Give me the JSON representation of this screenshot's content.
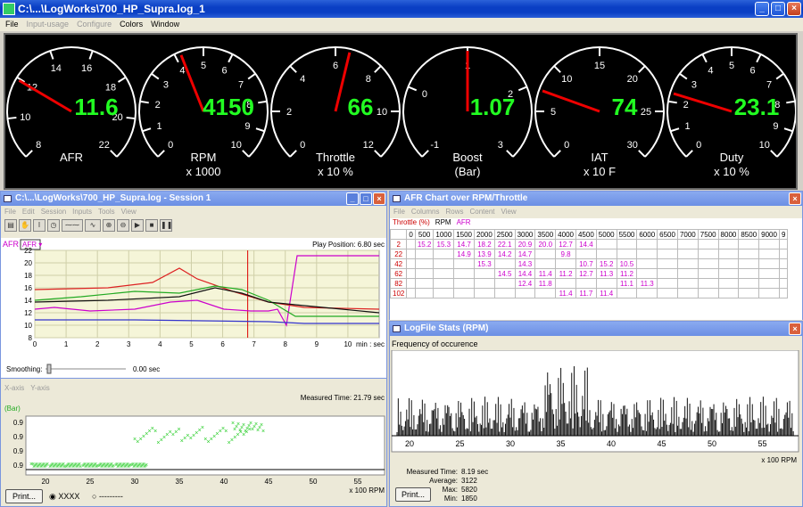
{
  "app": {
    "title": "C:\\...\\LogWorks\\700_HP_Supra.log_1"
  },
  "menu": {
    "items": [
      "File",
      "Input-usage",
      "Configure",
      "Colors",
      "Window"
    ],
    "disabled": [
      false,
      true,
      true,
      false,
      false
    ]
  },
  "gauges": [
    {
      "label": "AFR",
      "sub": "",
      "value": "11.6",
      "ticks": [
        "8",
        "10",
        "12",
        "14",
        "16",
        "18",
        "20",
        "22"
      ],
      "needle": 0.28
    },
    {
      "label": "RPM",
      "sub": "x 1000",
      "value": "4150",
      "ticks": [
        "0",
        "1",
        "2",
        "3",
        "4",
        "5",
        "6",
        "7",
        "8",
        "9",
        "10"
      ],
      "needle": 0.42
    },
    {
      "label": "Throttle",
      "sub": "x 10 %",
      "value": "66",
      "ticks": [
        "0",
        "2",
        "4",
        "6",
        "8",
        "10",
        "12"
      ],
      "needle": 0.55
    },
    {
      "label": "Boost",
      "sub": "(Bar)",
      "value": "1.07",
      "ticks": [
        "-1",
        "0",
        "1",
        "2",
        "3"
      ],
      "needle": 0.5
    },
    {
      "label": "IAT",
      "sub": "x 10 F",
      "value": "74",
      "ticks": [
        "0",
        "5",
        "10",
        "15",
        "20",
        "25",
        "30"
      ],
      "needle": 0.24
    },
    {
      "label": "Duty",
      "sub": "x 10 %",
      "value": "23.1",
      "ticks": [
        "0",
        "1",
        "2",
        "3",
        "4",
        "5",
        "6",
        "7",
        "8",
        "9",
        "10"
      ],
      "needle": 0.23
    }
  ],
  "session": {
    "title": "C:\\...\\LogWorks\\700_HP_Supra.log - Session 1",
    "menu": [
      "File",
      "Edit",
      "Session",
      "Inputs",
      "Tools",
      "View"
    ],
    "channel_label": "AFR",
    "channel_select": "AFR",
    "play_position": "Play Position: 6.80 sec",
    "yticks": [
      "8",
      "10",
      "12",
      "14",
      "16",
      "18",
      "20",
      "22"
    ],
    "xticks": [
      "0",
      "1",
      "2",
      "3",
      "4",
      "5",
      "6",
      "7",
      "8",
      "9",
      "10"
    ],
    "xunit": "min : sec",
    "smoothing_label": "Smoothing:",
    "smoothing_value": "0.00 sec"
  },
  "scatter": {
    "menu": [
      "X-axis",
      "Y-axis"
    ],
    "measured_time": "Measured Time: 21.79 sec",
    "unit": "(Bar)",
    "yticks": [
      "0.9",
      "0.9",
      "0.9",
      "0.9"
    ],
    "xticks": [
      "20",
      "25",
      "30",
      "35",
      "40",
      "45",
      "50",
      "55"
    ],
    "xunit": "x 100 RPM",
    "print": "Print...",
    "radio1": "XXXX",
    "radio2": "---------"
  },
  "afr_table": {
    "title": "AFR Chart over RPM/Throttle",
    "menu": [
      "File",
      "Columns",
      "Rows",
      "Content",
      "View"
    ],
    "tabs": [
      "Throttle (%)",
      "RPM",
      "AFR"
    ],
    "cols": [
      "0",
      "500",
      "1000",
      "1500",
      "2000",
      "2500",
      "3000",
      "3500",
      "4000",
      "4500",
      "5000",
      "5500",
      "6000",
      "6500",
      "7000",
      "7500",
      "8000",
      "8500",
      "9000",
      "9"
    ],
    "rows": [
      {
        "h": "2",
        "c": [
          "",
          "15.2",
          "15.3",
          "14.7",
          "18.2",
          "22.1",
          "20.9",
          "20.0",
          "12.7",
          "14.4",
          "",
          "",
          "",
          "",
          "",
          "",
          "",
          "",
          "",
          ""
        ]
      },
      {
        "h": "22",
        "c": [
          "",
          "",
          "",
          "14.9",
          "13.9",
          "14.2",
          "14.7",
          "",
          "9.8",
          "",
          "",
          "",
          "",
          "",
          "",
          "",
          "",
          "",
          "",
          ""
        ]
      },
      {
        "h": "42",
        "c": [
          "",
          "",
          "",
          "",
          "15.3",
          "",
          "14.3",
          "",
          "",
          "10.7",
          "15.2",
          "10.5",
          "",
          "",
          "",
          "",
          "",
          "",
          "",
          ""
        ]
      },
      {
        "h": "62",
        "c": [
          "",
          "",
          "",
          "",
          "",
          "14.5",
          "14.4",
          "11.4",
          "11.2",
          "12.7",
          "11.3",
          "11.2",
          "",
          "",
          "",
          "",
          "",
          "",
          "",
          ""
        ]
      },
      {
        "h": "82",
        "c": [
          "",
          "",
          "",
          "",
          "",
          "",
          "12.4",
          "11.8",
          "",
          "",
          "",
          "11.1",
          "11.3",
          "",
          "",
          "",
          "",
          "",
          "",
          ""
        ]
      },
      {
        "h": "102",
        "c": [
          "",
          "",
          "",
          "",
          "",
          "",
          "",
          "",
          "11.4",
          "11.7",
          "11.4",
          "",
          "",
          "",
          "",
          "",
          "",
          "",
          "",
          ""
        ]
      }
    ]
  },
  "stats": {
    "title": "LogFile Stats (RPM)",
    "chart_title": "Frequency of occurence",
    "xticks": [
      "20",
      "25",
      "30",
      "35",
      "40",
      "45",
      "50",
      "55"
    ],
    "xunit": "x 100 RPM",
    "measured_label": "Measured Time:",
    "measured": "8.19 sec",
    "average_label": "Average:",
    "average": "3122",
    "max_label": "Max:",
    "max": "5820",
    "min_label": "Min:",
    "min": "1850",
    "print": "Print..."
  }
}
